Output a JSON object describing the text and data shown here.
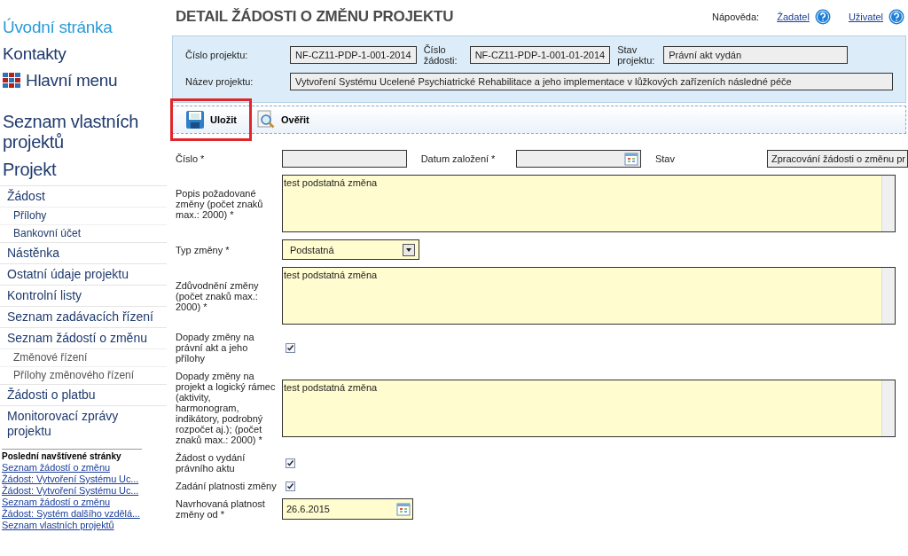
{
  "sidebar": {
    "top_links": [
      {
        "label": "Úvodní stránka",
        "kind": "home"
      },
      {
        "label": "Kontakty",
        "kind": "plain"
      },
      {
        "label": "Hlavní menu",
        "kind": "menu"
      }
    ],
    "sections": [
      {
        "title": "Seznam vlastních projektů"
      },
      {
        "title": "Projekt"
      }
    ],
    "nav": [
      {
        "label": "Žádost",
        "children": [
          {
            "label": "Přílohy",
            "current": false
          },
          {
            "label": "Bankovní účet",
            "current": false
          }
        ]
      },
      {
        "label": "Nástěnka"
      },
      {
        "label": "Ostatní údaje projektu"
      },
      {
        "label": "Kontrolní listy"
      },
      {
        "label": "Seznam zadávacích řízení"
      },
      {
        "label": "Seznam žádostí o změnu",
        "children": [
          {
            "label": "Změnové řízení",
            "current": true
          },
          {
            "label": "Přílohy změnového řízení",
            "current": true
          }
        ]
      },
      {
        "label": "Žádosti o platbu"
      },
      {
        "label": "Monitorovací zprávy projektu"
      }
    ],
    "recent": {
      "title": "Poslední navštívené stránky",
      "links": [
        "Seznam žádostí o změnu",
        "Žádost: Vytvoření Systému Uc...",
        "Žádost: Vytvoření Systému Uc...",
        "Seznam žádostí o změnu",
        "Žádost: Systém dalšího vzdělá...",
        "Seznam vlastních projektů"
      ]
    }
  },
  "page_title": "DETAIL ŽÁDOSTI O ZMĚNU PROJEKTU",
  "help": {
    "label": "Nápověda:",
    "links": [
      "Žadatel",
      "Uživatel"
    ]
  },
  "project_header": {
    "row_1": [
      {
        "label": "Číslo projektu:",
        "value": "NF-CZ11-PDP-1-001-2014"
      },
      {
        "label": "Číslo žádosti:",
        "value": "NF-CZ11-PDP-1-001-01-2014"
      },
      {
        "label": "Stav projektu:",
        "value": "Právní akt vydán"
      }
    ],
    "row_2": {
      "label": "Název projektu:",
      "value": "Vytvoření Systému Ucelené Psychiatrické Rehabilitace a jeho implementace v lůžkových zařízeních následné péče"
    }
  },
  "toolbar": [
    {
      "label": "Uložit",
      "kind": "save",
      "highlighted": true
    },
    {
      "label": "Ověřit",
      "kind": "verify",
      "highlighted": false
    }
  ],
  "form": [
    {
      "fields": [
        {
          "label": "Číslo *",
          "kind": "text"
        },
        {
          "label": "Datum založení *",
          "kind": "date"
        },
        {
          "label": "Stav",
          "kind": "text",
          "value": "Zpracování žádosti o změnu pr"
        }
      ]
    },
    {
      "fields": [
        {
          "label": "Popis požadované změny (počet znaků max.: 2000) *",
          "kind": "textarea",
          "value": "test podstatná změna"
        }
      ]
    },
    {
      "fields": [
        {
          "label": "Typ změny *",
          "kind": "select",
          "value": "Podstatná"
        }
      ]
    },
    {
      "fields": [
        {
          "label": "Zdůvodnění změny (počet znaků max.: 2000) *",
          "kind": "textarea",
          "value": "test podstatná změna"
        }
      ]
    },
    {
      "fields": [
        {
          "label": "Dopady změny na právní akt a jeho přílohy",
          "kind": "checkbox",
          "checked": true
        }
      ]
    },
    {
      "fields": [
        {
          "label": "Dopady změny na projekt a logický rámec (aktivity, harmonogram, indikátory, podrobný rozpočet aj.); (počet znaků max.: 2000) *",
          "kind": "textarea",
          "value": "test podstatná změna"
        }
      ]
    },
    {
      "fields": [
        {
          "label": "Žádost o vydání právního aktu",
          "kind": "checkbox",
          "checked": true
        }
      ]
    },
    {
      "fields": [
        {
          "label": "Zadání platnosti změny",
          "kind": "checkbox",
          "checked": true
        }
      ]
    },
    {
      "fields": [
        {
          "label": "Navrhovaná platnost změny od *",
          "kind": "date",
          "value": "26.6.2015"
        }
      ]
    }
  ]
}
